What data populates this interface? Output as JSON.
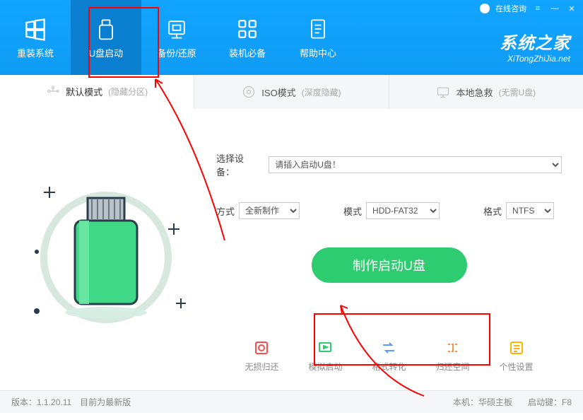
{
  "titlebar": {
    "consult": "在线咨询"
  },
  "nav": {
    "items": [
      {
        "label": "重装系统"
      },
      {
        "label": "U盘启动"
      },
      {
        "label": "备份/还原"
      },
      {
        "label": "装机必备"
      },
      {
        "label": "帮助中心"
      }
    ]
  },
  "brand": {
    "title": "系统之家",
    "sub": "XiTongZhiJia.net"
  },
  "modes": {
    "items": [
      {
        "label": "默认模式",
        "note": "(隐藏分区)"
      },
      {
        "label": "ISO模式",
        "note": "(深度隐藏)"
      },
      {
        "label": "本地急救",
        "note": "(无需U盘)"
      }
    ]
  },
  "form": {
    "device_label": "选择设备：",
    "device_value": "请插入启动U盘！",
    "method_label": "方式",
    "method_value": "全新制作",
    "mode_label": "模式",
    "mode_value": "HDD-FAT32",
    "fmt_label": "格式",
    "fmt_value": "NTFS",
    "create": "制作启动U盘"
  },
  "actions": {
    "items": [
      {
        "label": "无损归还",
        "color": "#ff4d4d"
      },
      {
        "label": "模拟启动",
        "color": "#2ecc71"
      },
      {
        "label": "格式转化",
        "color": "#5b9bff"
      },
      {
        "label": "归还空间",
        "color": "#ff914d"
      },
      {
        "label": "个性设置",
        "color": "#ffb400"
      }
    ]
  },
  "footer": {
    "version": "版本：1.1.20.11　目前为最新版",
    "board": "本机：华硕主板",
    "bootkey": "启动键：F8"
  }
}
